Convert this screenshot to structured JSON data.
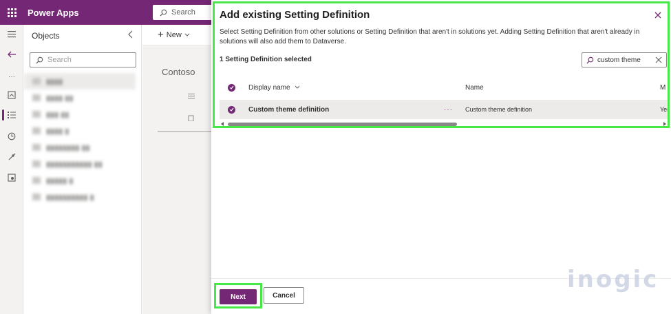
{
  "header": {
    "app_title": "Power Apps",
    "search_placeholder": "Search"
  },
  "objects_panel": {
    "title": "Objects",
    "search_placeholder": "Search"
  },
  "command_bar": {
    "new_label": "New"
  },
  "breadcrumb": {
    "root": "Contoso"
  },
  "dialog": {
    "title": "Add existing Setting Definition",
    "description": "Select Setting Definition from other solutions or Setting Definition that aren't in solutions yet. Adding Setting Definition that aren't already in solutions will also add them to Dataverse.",
    "selected_count": "1 Setting Definition selected",
    "filter_value": "custom theme",
    "columns": {
      "display_name": "Display name",
      "name": "Name",
      "managed": "M"
    },
    "rows": [
      {
        "display_name": "Custom theme definition",
        "name": "Custom theme definition",
        "managed": "Yes",
        "more": "···"
      }
    ],
    "buttons": {
      "next": "Next",
      "cancel": "Cancel"
    }
  },
  "watermark": "inogic",
  "colors": {
    "brand": "#742774",
    "highlight": "#46e846"
  }
}
